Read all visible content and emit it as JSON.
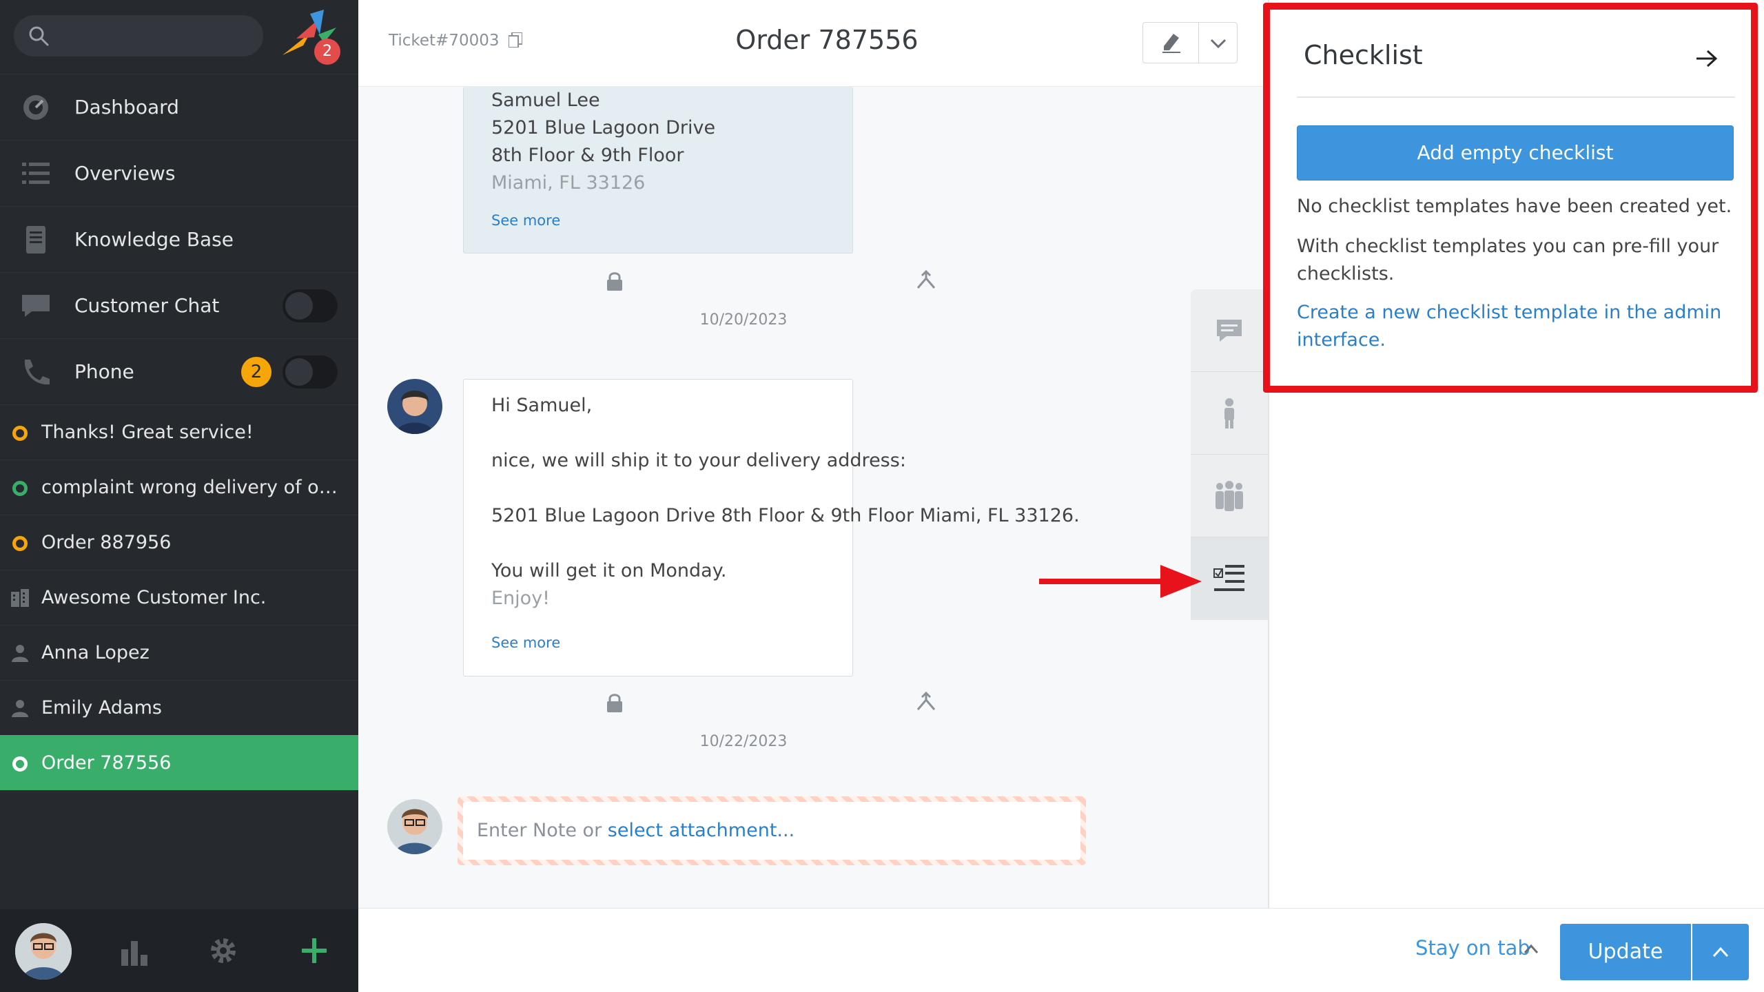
{
  "sidebar": {
    "logo_badge": "2",
    "nav": [
      {
        "label": "Dashboard"
      },
      {
        "label": "Overviews"
      },
      {
        "label": "Knowledge Base"
      },
      {
        "label": "Customer Chat"
      },
      {
        "label": "Phone",
        "badge": "2"
      }
    ],
    "tabs": [
      {
        "label": "Thanks! Great service!",
        "icon": "ring-orange"
      },
      {
        "label": "complaint wrong delivery of ord...",
        "icon": "ring-green"
      },
      {
        "label": "Order 887956",
        "icon": "ring-orange"
      },
      {
        "label": "Awesome Customer Inc.",
        "icon": "building-icon"
      },
      {
        "label": "Anna Lopez",
        "icon": "person-icon"
      },
      {
        "label": "Emily Adams",
        "icon": "person-icon"
      },
      {
        "label": "Order 787556",
        "icon": "ring-white",
        "active": true
      }
    ]
  },
  "ticket": {
    "number": "Ticket#70003",
    "title": "Order 787556"
  },
  "articles": [
    {
      "lines": [
        "Samuel Lee",
        "5201 Blue Lagoon Drive",
        "8th Floor & 9th Floor",
        "Miami, FL 33126"
      ],
      "see_more": "See more",
      "date": "10/20/2023"
    },
    {
      "lines": [
        "Hi Samuel,",
        "nice, we will ship it to your delivery address:",
        "5201 Blue Lagoon Drive 8th Floor & 9th Floor Miami, FL 33126.",
        "You will get it on Monday.",
        "Enjoy!"
      ],
      "see_more": "See more",
      "date": "10/22/2023"
    }
  ],
  "note": {
    "placeholder": "Enter Note or ",
    "attachment_link": "select attachment..."
  },
  "checklist": {
    "title": "Checklist",
    "add_button": "Add empty checklist",
    "no_templates": "No checklist templates have been created yet.",
    "info": "With checklist templates you can pre-fill your checklists.",
    "admin_link": "Create a new checklist template in the admin interface."
  },
  "bottom": {
    "stay_on_tab": "Stay on tab",
    "update": "Update"
  },
  "colors": {
    "sidebar_bg": "#26292e",
    "active_tab": "#38ae6a",
    "accent_blue": "#3c95dd",
    "badge_orange": "#f6a609",
    "annotation_red": "#e8121a"
  }
}
